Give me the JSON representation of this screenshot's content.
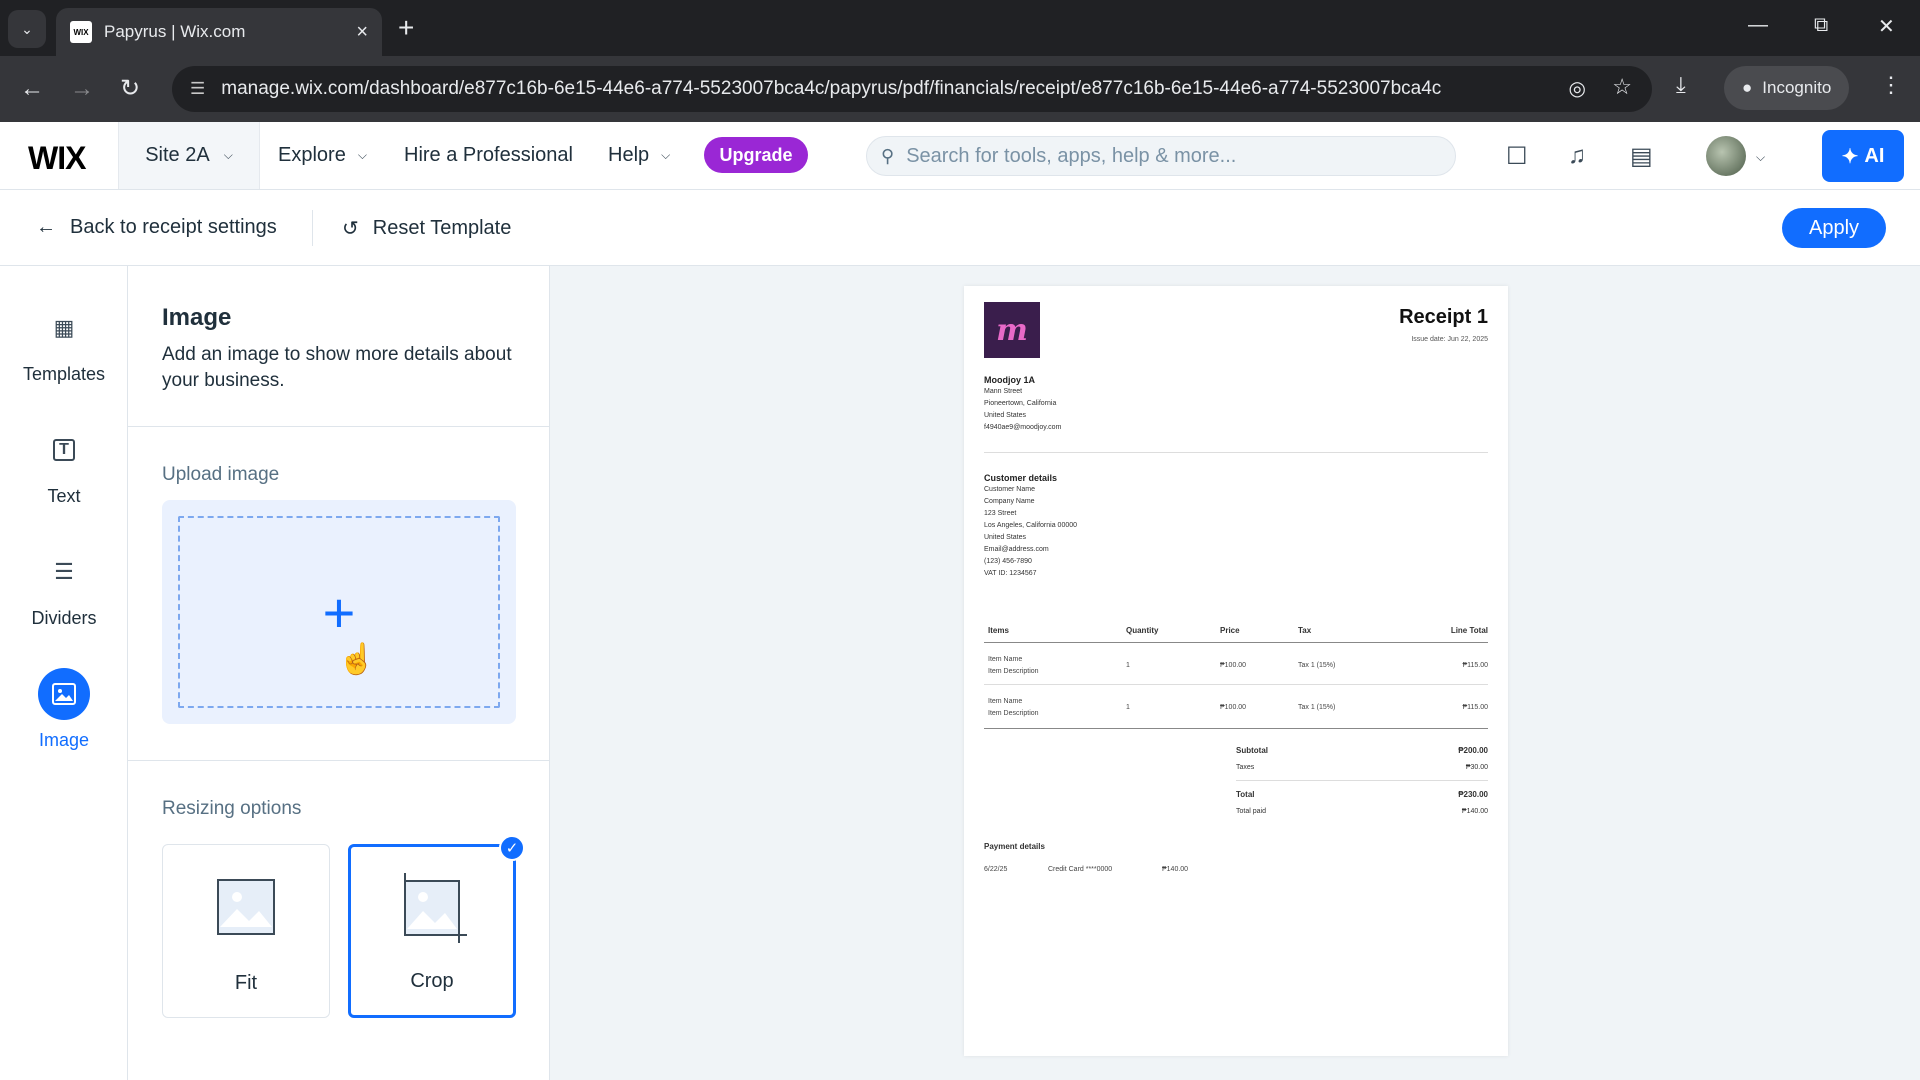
{
  "browser": {
    "tab_title": "Papyrus | Wix.com",
    "favicon_text": "WIX",
    "url": "manage.wix.com/dashboard/e877c16b-6e15-44e6-a774-5523007bca4c/papyrus/pdf/financials/receipt/e877c16b-6e15-44e6-a774-5523007bca4c",
    "incognito_label": "Incognito"
  },
  "header": {
    "logo": "WIX",
    "site_name": "Site 2A",
    "explore": "Explore",
    "hire": "Hire a Professional",
    "help": "Help",
    "upgrade": "Upgrade",
    "search_placeholder": "Search for tools, apps, help & more...",
    "ai_label": "AI"
  },
  "toolbar": {
    "back_label": "Back to receipt settings",
    "reset_label": "Reset Template",
    "apply_label": "Apply"
  },
  "rail": {
    "items": [
      {
        "label": "Templates",
        "icon": "templates-icon"
      },
      {
        "label": "Text",
        "icon": "text-icon"
      },
      {
        "label": "Dividers",
        "icon": "dividers-icon"
      },
      {
        "label": "Image",
        "icon": "image-icon"
      }
    ],
    "active": "Image"
  },
  "panel": {
    "title": "Image",
    "description": "Add an image to show more details about your business.",
    "upload_label": "Upload image",
    "resizing_label": "Resizing options",
    "options": [
      {
        "label": "Fit",
        "selected": false
      },
      {
        "label": "Crop",
        "selected": true
      }
    ]
  },
  "receipt": {
    "title": "Receipt 1",
    "issue_date": "Issue date: Jun 22, 2025",
    "business": {
      "name": "Moodjoy 1A",
      "lines": [
        "Mann Street",
        "Pioneertown, California",
        "United States",
        "f4940ae9@moodjoy.com"
      ]
    },
    "customer": {
      "heading": "Customer details",
      "lines": [
        "Customer Name",
        "Company Name",
        "123 Street",
        "Los Angeles, California 00000",
        "United States",
        "Email@address.com",
        "(123) 456-7890",
        "VAT ID: 1234567"
      ]
    },
    "table": {
      "headers": [
        "Items",
        "Quantity",
        "Price",
        "Tax",
        "Line Total"
      ],
      "rows": [
        {
          "name": "Item Name",
          "desc": "Item Description",
          "qty": "1",
          "price": "₱100.00",
          "tax": "Tax 1 (15%)",
          "total": "₱115.00"
        },
        {
          "name": "Item Name",
          "desc": "Item Description",
          "qty": "1",
          "price": "₱100.00",
          "tax": "Tax 1 (15%)",
          "total": "₱115.00"
        }
      ]
    },
    "summary": {
      "subtotal_label": "Subtotal",
      "subtotal": "₱200.00",
      "taxes_label": "Taxes",
      "taxes": "₱30.00",
      "total_label": "Total",
      "total": "₱230.00",
      "paid_label": "Total paid",
      "paid": "₱140.00"
    },
    "payment": {
      "heading": "Payment details",
      "date": "6/22/25",
      "method": "Credit Card ****0000",
      "amount": "₱140.00"
    }
  },
  "colors": {
    "accent": "#116dff",
    "upgrade": "#9a27d5"
  }
}
